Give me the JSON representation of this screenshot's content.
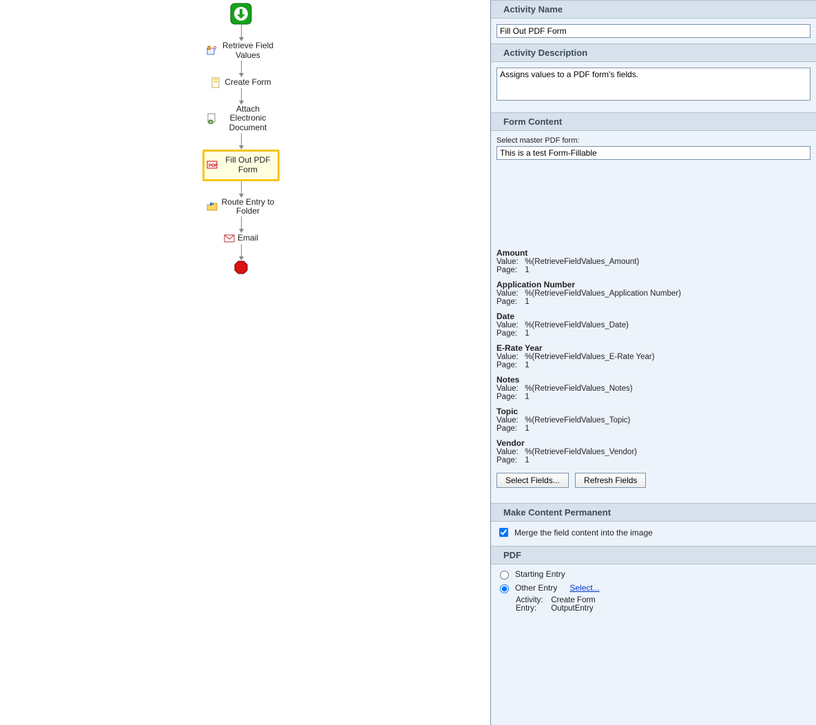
{
  "workflow": {
    "nodes": [
      {
        "id": "start",
        "label": ""
      },
      {
        "id": "retrieve",
        "label": "Retrieve Field Values"
      },
      {
        "id": "createform",
        "label": "Create Form"
      },
      {
        "id": "attachdoc",
        "label": "Attach Electronic Document"
      },
      {
        "id": "fillpdf",
        "label": "Fill Out PDF Form"
      },
      {
        "id": "route",
        "label": "Route Entry to Folder"
      },
      {
        "id": "email",
        "label": "Email"
      },
      {
        "id": "stop",
        "label": ""
      }
    ]
  },
  "panel": {
    "sections": {
      "activity_name": "Activity Name",
      "activity_description": "Activity Description",
      "form_content": "Form Content",
      "make_permanent": "Make Content Permanent",
      "pdf": "PDF"
    },
    "activity_name_value": "Fill Out PDF Form",
    "activity_description_value": "Assigns values to a PDF form's fields.",
    "form_content": {
      "select_master_label": "Select master PDF form:",
      "master_value": "This is a test Form-Fillable",
      "fields": [
        {
          "name": "Amount",
          "value": "%(RetrieveFieldValues_Amount)",
          "page": "1"
        },
        {
          "name": "Application Number",
          "value": "%(RetrieveFieldValues_Application Number)",
          "page": "1"
        },
        {
          "name": "Date",
          "value": "%(RetrieveFieldValues_Date)",
          "page": "1"
        },
        {
          "name": "E-Rate Year",
          "value": "%(RetrieveFieldValues_E-Rate Year)",
          "page": "1"
        },
        {
          "name": "Notes",
          "value": "%(RetrieveFieldValues_Notes)",
          "page": "1"
        },
        {
          "name": "Topic",
          "value": "%(RetrieveFieldValues_Topic)",
          "page": "1"
        },
        {
          "name": "Vendor",
          "value": "%(RetrieveFieldValues_Vendor)",
          "page": "1"
        }
      ],
      "value_label": "Value:",
      "page_label": "Page:",
      "select_fields_btn": "Select Fields...",
      "refresh_fields_btn": "Refresh Fields"
    },
    "make_permanent": {
      "checked": true,
      "label": "Merge the field content into the image"
    },
    "pdf": {
      "starting_entry_label": "Starting Entry",
      "other_entry_label": "Other Entry",
      "selected": "other",
      "select_link": "Select...",
      "activity_label": "Activity:",
      "activity_value": "Create Form",
      "entry_label": "Entry:",
      "entry_value": "OutputEntry"
    }
  }
}
